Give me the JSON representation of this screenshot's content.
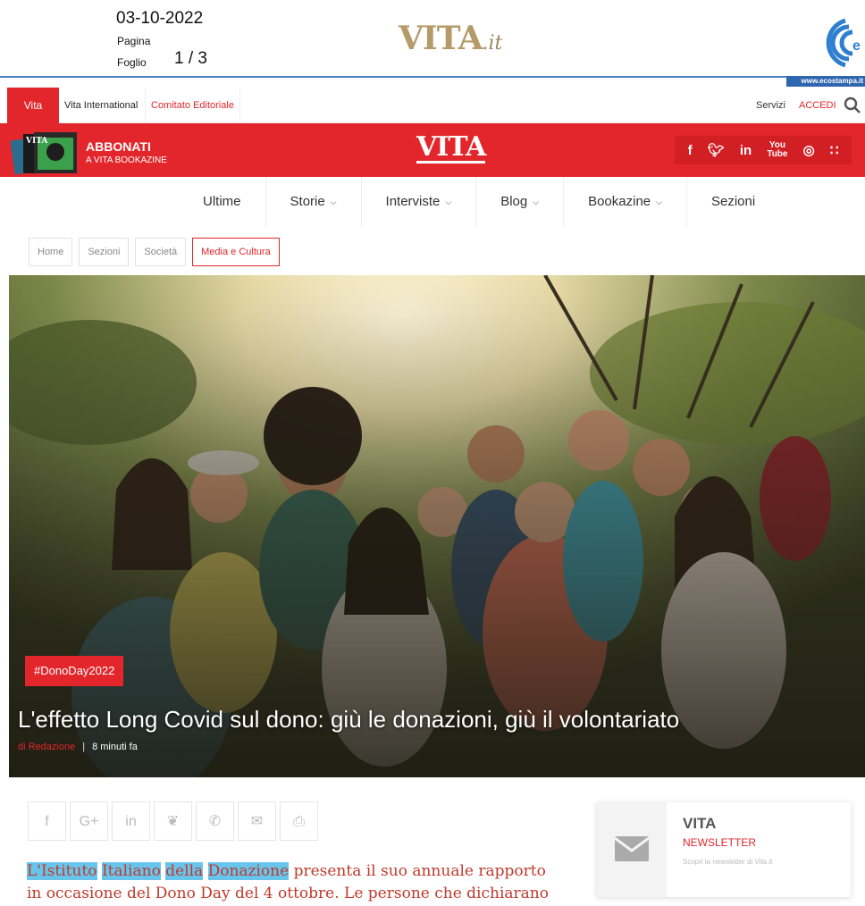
{
  "clipping": {
    "date": "03-10-2022",
    "pagina_label": "Pagina",
    "foglio_label": "Foglio",
    "page_num": "1 / 3",
    "logo_main": "VITA",
    "logo_suffix": ".it",
    "eco_url": "www.ecostampa.it"
  },
  "topnav": {
    "vita": "Vita",
    "international": "Vita International",
    "comitato": "Comitato Editoriale",
    "servizi": "Servizi",
    "accedi": "ACCEDI"
  },
  "brandbar": {
    "abbonati": "ABBONATI",
    "abbonati_sub": "A VITA BOOKAZINE",
    "logo": "VITA",
    "social_icons": [
      "facebook-icon",
      "twitter-icon",
      "linkedin-icon",
      "youtube-icon",
      "instagram-icon",
      "rss-icon"
    ],
    "accent": "#e2262b"
  },
  "mainnav": [
    "Ultime",
    "Storie",
    "Interviste",
    "Blog",
    "Bookazine",
    "Sezioni"
  ],
  "breadcrumb": [
    "Home",
    "Sezioni",
    "Società",
    "Media e Cultura"
  ],
  "article": {
    "tag": "#DonoDay2022",
    "title": "L'effetto Long Covid sul dono: giù le donazioni, giù il volontariato",
    "author_prefix": "di",
    "author": "Redazione",
    "time": "8 minuti fa",
    "lead_highlight": [
      "L'Istituto",
      "Italiano",
      "della",
      "Donazione"
    ],
    "lead_rest1": " presenta il suo annuale rapporto",
    "lead_line2": "in occasione del Dono Day del 4 ottobre. Le persone che dichiarano"
  },
  "share": [
    "facebook-icon",
    "google-plus-icon",
    "linkedin-icon",
    "twitter-icon",
    "whatsapp-icon",
    "email-icon",
    "print-icon"
  ],
  "newsletter": {
    "title": "VITA",
    "subtitle": "NEWSLETTER",
    "desc": "Scopri la newsletter di Vita.it"
  }
}
